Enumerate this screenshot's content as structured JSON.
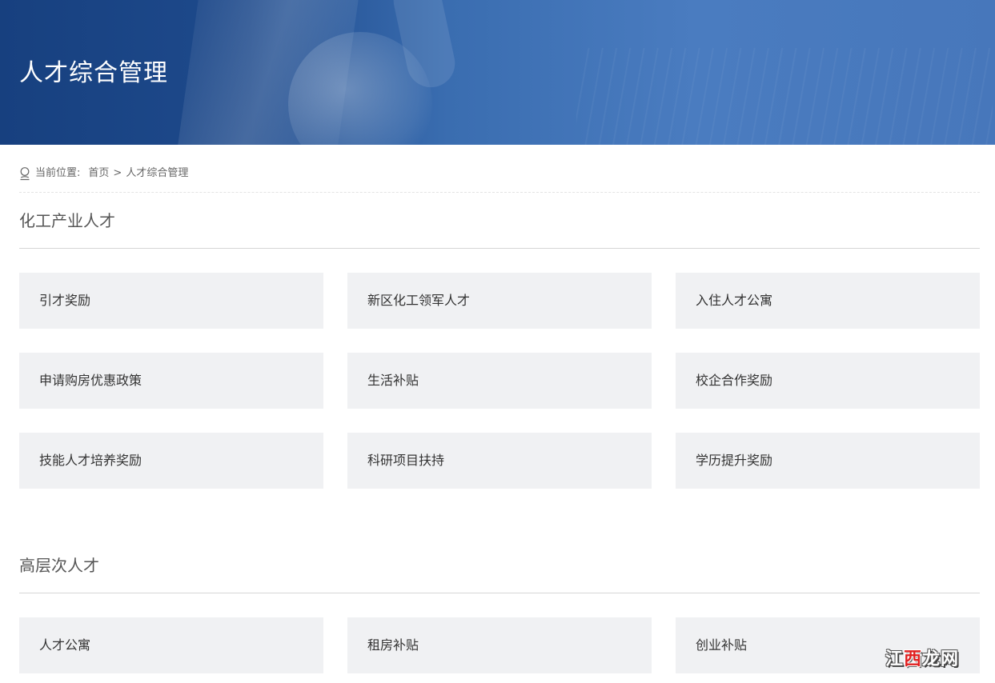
{
  "banner": {
    "title": "人才综合管理"
  },
  "breadcrumb": {
    "label": "当前位置:",
    "home": "首页",
    "separator": ">",
    "current": "人才综合管理"
  },
  "sections": [
    {
      "title": "化工产业人才",
      "items": [
        "引才奖励",
        "新区化工领军人才",
        "入住人才公寓",
        "申请购房优惠政策",
        "生活补贴",
        "校企合作奖励",
        "技能人才培养奖励",
        "科研项目扶持",
        "学历提升奖励"
      ]
    },
    {
      "title": "高层次人才",
      "items": [
        "人才公寓",
        "租房补贴",
        "创业补贴"
      ]
    }
  ],
  "watermark": {
    "part1": "江",
    "part2": "西",
    "part3": "龙网"
  },
  "colors": {
    "banner_dark": "#17407f",
    "banner_light": "#4a7cc0",
    "card_bg": "#f0f1f3"
  }
}
